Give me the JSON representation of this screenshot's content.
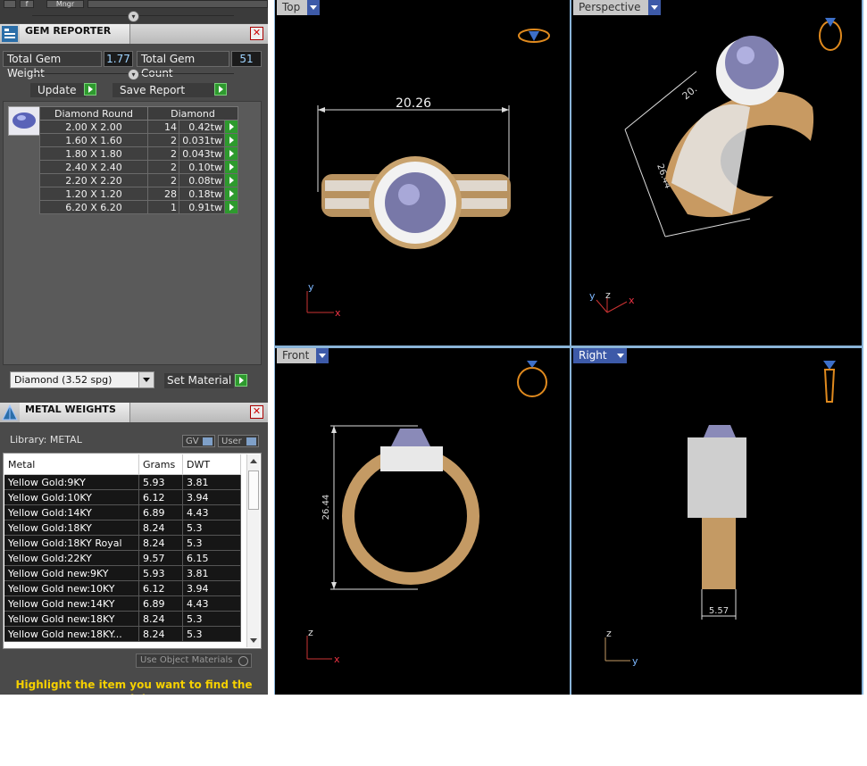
{
  "toolbar": {
    "btn1": "",
    "btn2": "f",
    "btn3": "Mngr"
  },
  "gem_reporter": {
    "title": "GEM REPORTER",
    "total_weight_label": "Total Gem Weight",
    "total_weight": "1.77",
    "total_count_label": "Total Gem Count",
    "total_count": "51",
    "update_label": "Update",
    "save_report_label": "Save Report",
    "table": {
      "headers": [
        "Diamond Round",
        "Diamond"
      ],
      "rows": [
        {
          "size": "2.00 X 2.00",
          "count": "14",
          "weight": "0.42tw"
        },
        {
          "size": "1.60 X 1.60",
          "count": "2",
          "weight": "0.031tw"
        },
        {
          "size": "1.80 X 1.80",
          "count": "2",
          "weight": "0.043tw"
        },
        {
          "size": "2.40 X 2.40",
          "count": "2",
          "weight": "0.10tw"
        },
        {
          "size": "2.20 X 2.20",
          "count": "2",
          "weight": "0.08tw"
        },
        {
          "size": "1.20 X 1.20",
          "count": "28",
          "weight": "0.18tw"
        },
        {
          "size": "6.20 X 6.20",
          "count": "1",
          "weight": "0.91tw"
        }
      ]
    },
    "material_selected": "Diamond    (3.52 spg)",
    "set_material_label": "Set Material"
  },
  "metal_weights": {
    "title": "METAL WEIGHTS",
    "library_label": "Library: METAL",
    "gv_label": "GV",
    "user_label": "User",
    "headers": [
      "Metal",
      "Grams",
      "DWT"
    ],
    "rows": [
      {
        "metal": "Yellow Gold:9KY",
        "grams": "5.93",
        "dwt": "3.81"
      },
      {
        "metal": "Yellow Gold:10KY",
        "grams": "6.12",
        "dwt": "3.94"
      },
      {
        "metal": "Yellow Gold:14KY",
        "grams": "6.89",
        "dwt": "4.43"
      },
      {
        "metal": "Yellow Gold:18KY",
        "grams": "8.24",
        "dwt": "5.3"
      },
      {
        "metal": "Yellow Gold:18KY Royal",
        "grams": "8.24",
        "dwt": "5.3"
      },
      {
        "metal": "Yellow Gold:22KY",
        "grams": "9.57",
        "dwt": "6.15"
      },
      {
        "metal": "Yellow Gold new:9KY",
        "grams": "5.93",
        "dwt": "3.81"
      },
      {
        "metal": "Yellow Gold new:10KY",
        "grams": "6.12",
        "dwt": "3.94"
      },
      {
        "metal": "Yellow Gold new:14KY",
        "grams": "6.89",
        "dwt": "4.43"
      },
      {
        "metal": "Yellow Gold new:18KY",
        "grams": "8.24",
        "dwt": "5.3"
      },
      {
        "metal": "Yellow Gold new:18KY...",
        "grams": "8.24",
        "dwt": "5.3"
      }
    ],
    "use_object_materials_label": "Use Object Materials",
    "hint": "Highlight the item you want to find the weight"
  },
  "viewports": {
    "top": {
      "label": "Top",
      "dimension": "20.26",
      "axis_y": "y",
      "axis_x": "x"
    },
    "perspective": {
      "label": "Perspective",
      "dim_a": "20.",
      "dim_b": "26.44",
      "axis_y": "y",
      "axis_z": "z",
      "axis_x": "x"
    },
    "front": {
      "label": "Front",
      "dimension": "26.44",
      "axis_z": "z",
      "axis_x": "x"
    },
    "right": {
      "label": "Right",
      "dimension": "5.57",
      "axis_z": "z",
      "axis_y": "y"
    }
  },
  "colors": {
    "accent_blue": "#3d5aa8",
    "gold": "#d8b27a",
    "hint_yellow": "#f5d000",
    "go_green": "#2e9a2e"
  }
}
